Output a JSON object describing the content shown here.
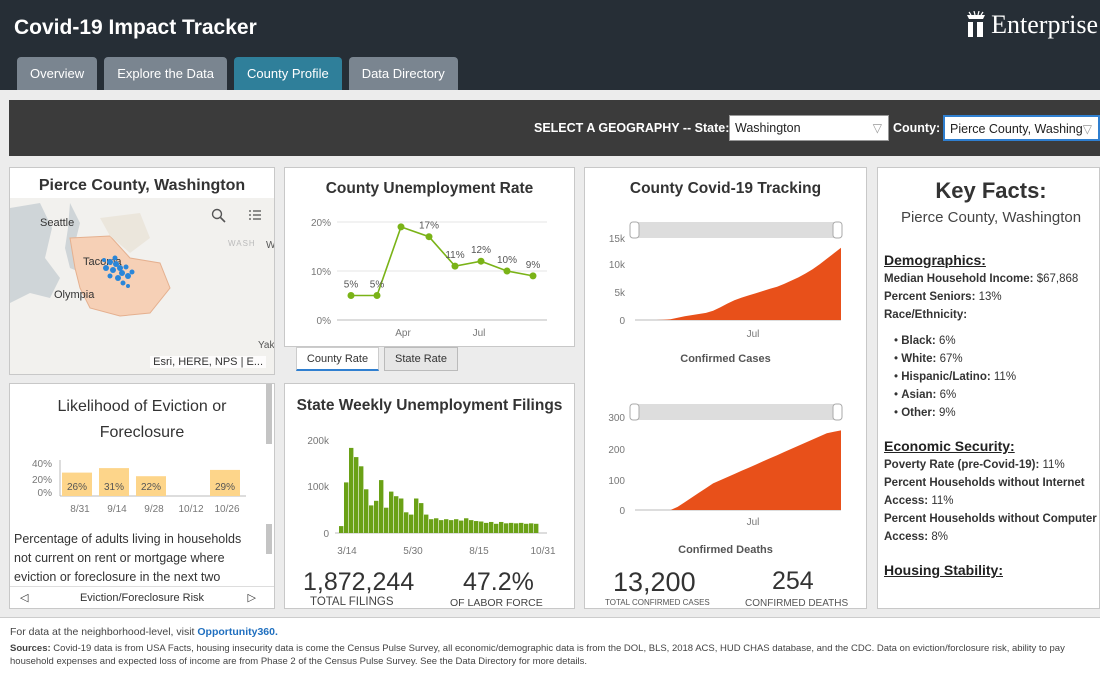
{
  "header": {
    "title": "Covid-19 Impact Tracker",
    "brand": "Enterprise"
  },
  "tabs": [
    {
      "label": "Overview"
    },
    {
      "label": "Explore the Data"
    },
    {
      "label": "County Profile"
    },
    {
      "label": "Data Directory"
    }
  ],
  "selector": {
    "label": "SELECT A GEOGRAPHY -- State:",
    "state_value": "Washington",
    "county_label": "County:",
    "county_value": "Pierce County, Washing"
  },
  "map_panel": {
    "title": "Pierce County, Washington",
    "labels": {
      "seattle": "Seattle",
      "tacoma": "Tacoma",
      "olympia": "Olympia",
      "wash": "WASH",
      "w": "W",
      "yak": "Yak"
    },
    "attribution": "Esri, HERE, NPS | E..."
  },
  "eviction_panel": {
    "title": "Likelihood of Eviction or Foreclosure",
    "description": "Percentage of adults living in households not current on rent or mortgage where eviction or foreclosure in the next two",
    "nav_label": "Eviction/Foreclosure Risk",
    "chart_data": {
      "type": "bar",
      "categories": [
        "8/31",
        "9/14",
        "9/28",
        "10/12",
        "10/26"
      ],
      "values": [
        26,
        31,
        22,
        null,
        29
      ],
      "data_labels": [
        "26%",
        "31%",
        "22%",
        "",
        "29%"
      ],
      "yticks": [
        "40%",
        "20%",
        "0%"
      ],
      "ylim": [
        0,
        40
      ],
      "color": "#fdd58a"
    }
  },
  "unemployment_panel": {
    "title": "County Unemployment Rate",
    "tab_county": "County Rate",
    "tab_state": "State Rate",
    "chart_data": {
      "type": "line",
      "values": [
        5,
        5,
        19,
        17,
        11,
        12,
        10,
        9
      ],
      "data_labels": [
        "5%",
        "5%",
        "",
        "17%",
        "11%",
        "12%",
        "10%",
        "9%"
      ],
      "yticks": [
        "20%",
        "10%",
        "0%"
      ],
      "xticks": [
        "Apr",
        "Jul"
      ],
      "ylim": [
        0,
        20
      ],
      "color": "#7ab317"
    }
  },
  "filings_panel": {
    "title": "State Weekly Unemployment Filings",
    "total_filings": "1,872,244",
    "total_filings_label": "TOTAL FILINGS",
    "labor_force_pct": "47.2%",
    "labor_force_label": "OF LABOR FORCE",
    "chart_data": {
      "type": "bar",
      "xticks": [
        "3/14",
        "5/30",
        "8/15",
        "10/31"
      ],
      "yticks": [
        "200k",
        "100k",
        "0"
      ],
      "ylim": [
        0,
        200000
      ],
      "values": [
        15000,
        110000,
        185000,
        165000,
        145000,
        95000,
        60000,
        70000,
        115000,
        55000,
        90000,
        80000,
        75000,
        45000,
        40000,
        75000,
        65000,
        40000,
        30000,
        32000,
        28000,
        30000,
        28000,
        30000,
        27000,
        32000,
        28000,
        26000,
        25000,
        22000,
        24000,
        20000,
        24000,
        21000,
        22000,
        21000,
        22000,
        20000,
        21000,
        20000
      ],
      "color": "#6aa116"
    }
  },
  "covid_panel": {
    "title": "County Covid-19 Tracking",
    "cases_caption": "Confirmed Cases",
    "deaths_caption": "Confirmed Deaths",
    "total_cases": "13,200",
    "total_cases_label": "TOTAL CONFIRMED CASES",
    "total_deaths": "254",
    "total_deaths_label": "CONFIRMED DEATHS",
    "cases_chart": {
      "type": "area",
      "yticks": [
        "15k",
        "10k",
        "5k",
        "0"
      ],
      "xticks": [
        "Jul"
      ],
      "ylim": [
        0,
        15000
      ],
      "values": [
        0,
        0,
        0,
        0,
        50,
        150,
        400,
        700,
        900,
        1100,
        1300,
        1700,
        2300,
        3000,
        3600,
        4100,
        4500,
        4900,
        5300,
        5700,
        6100,
        6600,
        7200,
        7800,
        8500,
        9300,
        10200,
        11200,
        12200,
        13200
      ],
      "color": "#e8501a"
    },
    "deaths_chart": {
      "type": "area",
      "yticks": [
        "300",
        "200",
        "100",
        "0"
      ],
      "xticks": [
        "Jul"
      ],
      "ylim": [
        0,
        300
      ],
      "values": [
        0,
        0,
        0,
        0,
        0,
        0,
        10,
        25,
        40,
        55,
        70,
        85,
        95,
        105,
        115,
        125,
        135,
        145,
        155,
        165,
        175,
        185,
        195,
        205,
        215,
        225,
        235,
        245,
        250,
        254
      ],
      "color": "#e8501a"
    }
  },
  "key_facts": {
    "title": "Key Facts:",
    "subtitle": "Pierce County, Washington",
    "demographics_heading": "Demographics:",
    "median_income_label": "Median Household Income:",
    "median_income_value": "$67,868",
    "seniors_label": "Percent Seniors:",
    "seniors_value": "13%",
    "race_label": "Race/Ethnicity:",
    "race": [
      {
        "label": "Black:",
        "value": "6%"
      },
      {
        "label": "White:",
        "value": "67%"
      },
      {
        "label": "Hispanic/Latino:",
        "value": "11%"
      },
      {
        "label": "Asian:",
        "value": "6%"
      },
      {
        "label": "Other:",
        "value": "9%"
      }
    ],
    "economic_heading": "Economic Security:",
    "poverty_label": "Poverty Rate (pre-Covid-19):",
    "poverty_value": "11%",
    "internet_label": "Percent Households without Internet Access:",
    "internet_value": "11%",
    "computer_label": "Percent Households without Computer Access:",
    "computer_value": "8%",
    "housing_heading": "Housing Stability:"
  },
  "footer": {
    "line1_prefix": "For data at the neighborhood-level, visit",
    "line1_link": "Opportunity360.",
    "sources_label": "Sources:",
    "sources_text": "Covid-19 data is from USA Facts, housing insecurity data is come the Census Pulse Survey, all economic/demographic data is from the DOL, BLS, 2018 ACS, HUD CHAS database, and the CDC. Data on eviction/forclosure risk, ability to pay household expenses and expected loss of income are from Phase 2 of the Census Pulse Survey. See the Data Directory for more details."
  }
}
